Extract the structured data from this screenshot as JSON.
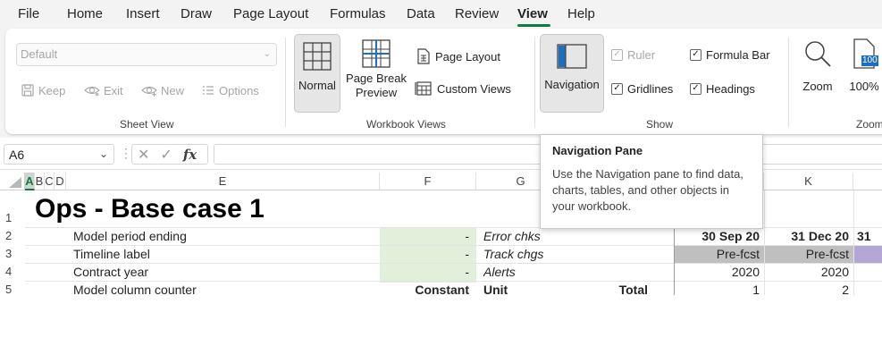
{
  "menu": {
    "tabs": [
      {
        "label": "File"
      },
      {
        "label": "Home"
      },
      {
        "label": "Insert"
      },
      {
        "label": "Draw"
      },
      {
        "label": "Page Layout"
      },
      {
        "label": "Formulas"
      },
      {
        "label": "Data"
      },
      {
        "label": "Review"
      },
      {
        "label": "View",
        "active": true
      },
      {
        "label": "Help"
      }
    ]
  },
  "ribbon": {
    "sheet_view": {
      "dropdown_value": "Default",
      "keep": "Keep",
      "exit": "Exit",
      "new": "New",
      "options": "Options",
      "group_label": "Sheet View"
    },
    "workbook_views": {
      "normal": "Normal",
      "page_break_line1": "Page Break",
      "page_break_line2": "Preview",
      "page_layout": "Page Layout",
      "custom_views": "Custom Views",
      "group_label": "Workbook Views"
    },
    "show": {
      "navigation": "Navigation",
      "ruler": "Ruler",
      "formula_bar": "Formula Bar",
      "gridlines": "Gridlines",
      "headings": "Headings",
      "group_label": "Show"
    },
    "zoom": {
      "zoom": "Zoom",
      "hundred": "100%",
      "icon_badge": "100",
      "group_label": "Zoom"
    }
  },
  "formula_bar": {
    "name_box": "A6",
    "content": ""
  },
  "grid": {
    "columns": [
      "A",
      "B",
      "C",
      "D",
      "E",
      "F",
      "G",
      "",
      "",
      "K"
    ],
    "rows": [
      "1",
      "2",
      "3",
      "4",
      "5"
    ],
    "title": "Ops - Base case 1",
    "r2": {
      "e": "Model period ending",
      "f": "-",
      "g": "Error chks",
      "j": "30 Sep 20",
      "k": "31 Dec 20",
      "l": "31"
    },
    "r3": {
      "e": "Timeline label",
      "f": "-",
      "g": "Track chgs",
      "j": "Pre-fcst",
      "k": "Pre-fcst"
    },
    "r4": {
      "e": "Contract year",
      "f": "-",
      "g": "Alerts",
      "j": "2020",
      "k": "2020"
    },
    "r5": {
      "e": "Model column counter",
      "f": "Constant",
      "g": "Unit",
      "h": "Total",
      "j": "1",
      "k": "2"
    }
  },
  "tooltip": {
    "title": "Navigation Pane",
    "body": "Use the Navigation pane to find data, charts, tables, and other objects in your workbook."
  },
  "colors": {
    "accent": "#107c41",
    "input_green": "#e2efda",
    "label_gray": "#bfbfbf",
    "label_purple": "#b4a7d6"
  }
}
